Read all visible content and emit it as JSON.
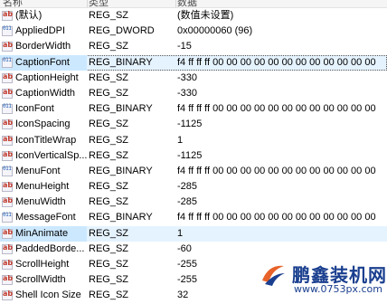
{
  "columns": {
    "name": "名称",
    "type": "类型",
    "data": "数据"
  },
  "rows": [
    {
      "name": "(默认)",
      "type": "REG_SZ",
      "data": "(数值未设置)",
      "icon": "string-value-icon"
    },
    {
      "name": "AppliedDPI",
      "type": "REG_DWORD",
      "data": "0x00000060 (96)",
      "icon": "binary-value-icon"
    },
    {
      "name": "BorderWidth",
      "type": "REG_SZ",
      "data": "-15",
      "icon": "string-value-icon"
    },
    {
      "name": "CaptionFont",
      "type": "REG_BINARY",
      "data": "f4 ff ff ff 00 00 00 00 00 00 00 00 00 00 00 00 00 ...",
      "icon": "binary-value-icon",
      "selected": true
    },
    {
      "name": "CaptionHeight",
      "type": "REG_SZ",
      "data": "-330",
      "icon": "string-value-icon"
    },
    {
      "name": "CaptionWidth",
      "type": "REG_SZ",
      "data": "-330",
      "icon": "string-value-icon"
    },
    {
      "name": "IconFont",
      "type": "REG_BINARY",
      "data": "f4 ff ff ff 00 00 00 00 00 00 00 00 00 00 00 00 00 ...",
      "icon": "binary-value-icon"
    },
    {
      "name": "IconSpacing",
      "type": "REG_SZ",
      "data": "-1125",
      "icon": "string-value-icon"
    },
    {
      "name": "IconTitleWrap",
      "type": "REG_SZ",
      "data": "1",
      "icon": "string-value-icon"
    },
    {
      "name": "IconVerticalSp...",
      "type": "REG_SZ",
      "data": "-1125",
      "icon": "string-value-icon"
    },
    {
      "name": "MenuFont",
      "type": "REG_BINARY",
      "data": "f4 ff ff ff 00 00 00 00 00 00 00 00 00 00 00 00 00 ...",
      "icon": "binary-value-icon"
    },
    {
      "name": "MenuHeight",
      "type": "REG_SZ",
      "data": "-285",
      "icon": "string-value-icon"
    },
    {
      "name": "MenuWidth",
      "type": "REG_SZ",
      "data": "-285",
      "icon": "string-value-icon"
    },
    {
      "name": "MessageFont",
      "type": "REG_BINARY",
      "data": "f4 ff ff ff 00 00 00 00 00 00 00 00 00 00 00 00 00 ...",
      "icon": "binary-value-icon"
    },
    {
      "name": "MinAnimate",
      "type": "REG_SZ",
      "data": "1",
      "icon": "string-value-icon",
      "hover": true
    },
    {
      "name": "PaddedBorde...",
      "type": "REG_SZ",
      "data": "-60",
      "icon": "string-value-icon"
    },
    {
      "name": "ScrollHeight",
      "type": "REG_SZ",
      "data": "-255",
      "icon": "string-value-icon"
    },
    {
      "name": "ScrollWidth",
      "type": "REG_SZ",
      "data": "-255",
      "icon": "string-value-icon"
    },
    {
      "name": "Shell Icon Size",
      "type": "REG_SZ",
      "data": "32",
      "icon": "string-value-icon"
    }
  ],
  "watermark": {
    "title": "鹏鑫装机网",
    "url": "www.0753px.com"
  }
}
